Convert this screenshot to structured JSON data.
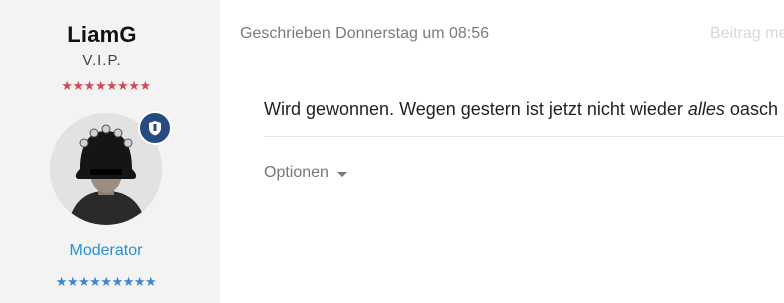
{
  "author": {
    "name": "LiamG",
    "rank": "V.I.P.",
    "rank_stars": "★★★★★★★★",
    "role": "Moderator",
    "role_stars": "★★★★★★★★★"
  },
  "post": {
    "timestamp": "Geschrieben Donnerstag um 08:56",
    "faded_link": "Beitrag me",
    "message_before": "Wird gewonnen. Wegen gestern ist jetzt nicht wieder ",
    "message_emphasis": "alles",
    "message_after": " oasch",
    "options_label": "Optionen"
  },
  "colors": {
    "accent": "#2a8fd4",
    "badge": "#274a82",
    "rank_stars": "#d14a57",
    "role_stars": "#3a86d6"
  },
  "icons": {
    "badge": "shield-icon",
    "dropdown": "chevron-down-icon"
  }
}
